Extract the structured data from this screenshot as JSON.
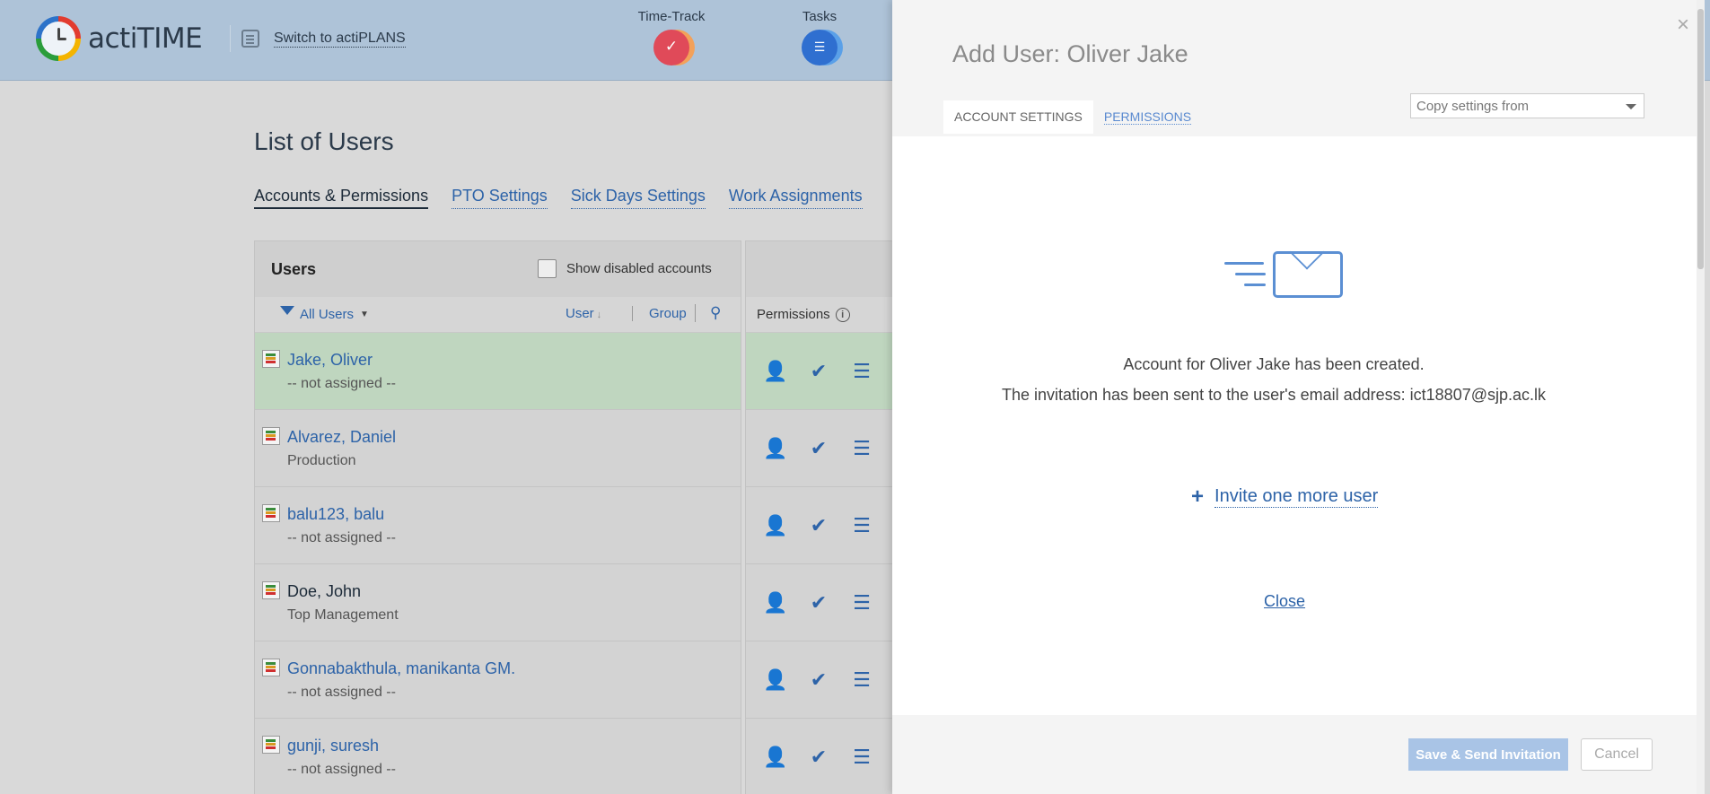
{
  "header": {
    "logo_text": "actiTIME",
    "switch_label": "Switch to actiPLANS",
    "nav": [
      {
        "label": "Time-Track",
        "icon": "time-track-icon"
      },
      {
        "label": "Tasks",
        "icon": "tasks-icon"
      }
    ]
  },
  "page": {
    "title": "List of Users",
    "subtabs": [
      "Accounts & Permissions",
      "PTO Settings",
      "Sick Days Settings",
      "Work Assignments"
    ],
    "users_panel": {
      "title": "Users",
      "show_disabled_label": "Show disabled accounts",
      "filter_label": "All Users",
      "sort_user_label": "User",
      "sort_group_label": "Group",
      "permissions_label": "Permissions"
    },
    "users": [
      {
        "name": "Jake, Oliver",
        "dept": "-- not assigned --"
      },
      {
        "name": "Alvarez, Daniel",
        "dept": "Production"
      },
      {
        "name": "balu123, balu",
        "dept": "-- not assigned --"
      },
      {
        "name": "Doe, John",
        "dept": "Top Management"
      },
      {
        "name": "Gonnabakthula, manikanta GM.",
        "dept": "-- not assigned --"
      },
      {
        "name": "gunji, suresh",
        "dept": "-- not assigned --"
      }
    ]
  },
  "modal": {
    "title": "Add User: Oliver Jake",
    "tabs": [
      "ACCOUNT SETTINGS",
      "PERMISSIONS"
    ],
    "copy_settings_placeholder": "Copy settings from",
    "message_line1": "Account for Oliver Jake has been created.",
    "message_line2": "The invitation has been sent to the user's email address: ict18807@sjp.ac.lk",
    "invite_label": "Invite one more user",
    "close_label": "Close",
    "save_button": "Save & Send Invitation",
    "cancel_button": "Cancel",
    "close_icon": "×"
  },
  "colors": {
    "accent": "#2d63a8",
    "topbar": "#aec3d8",
    "selected_row": "#bfd6bf",
    "save_button_disabled": "#a9c4e6"
  }
}
